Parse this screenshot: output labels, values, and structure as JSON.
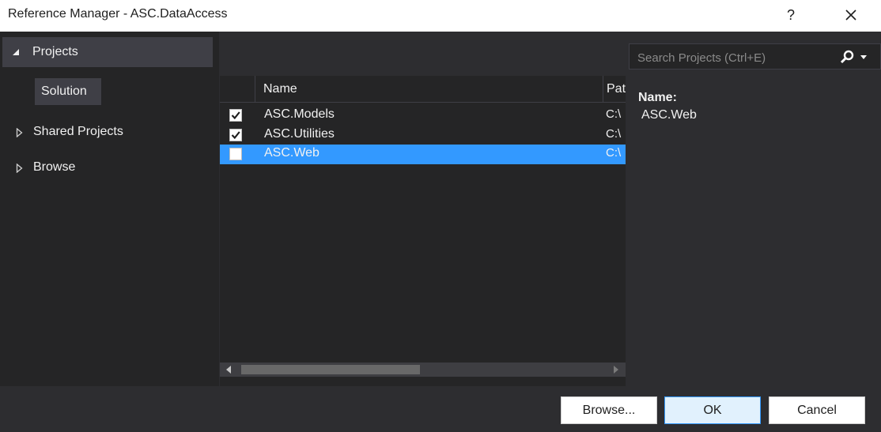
{
  "window": {
    "title": "Reference Manager - ASC.DataAccess"
  },
  "nav": {
    "header": "Projects",
    "selected_item": "Solution",
    "items": [
      {
        "label": "Shared Projects"
      },
      {
        "label": "Browse"
      }
    ]
  },
  "search": {
    "placeholder": "Search Projects (Ctrl+E)"
  },
  "list": {
    "columns": {
      "name": "Name",
      "path": "Path"
    },
    "rows": [
      {
        "name": "ASC.Models",
        "path": "C:\\",
        "checked": true,
        "selected": false
      },
      {
        "name": "ASC.Utilities",
        "path": "C:\\",
        "checked": true,
        "selected": false
      },
      {
        "name": "ASC.Web",
        "path": "C:\\",
        "checked": false,
        "selected": true
      }
    ]
  },
  "details": {
    "label": "Name:",
    "value": "ASC.Web"
  },
  "buttons": {
    "browse": "Browse...",
    "ok": "OK",
    "cancel": "Cancel"
  },
  "colors": {
    "selection": "#3399ff",
    "background": "#2d2d30",
    "panel": "#252526"
  }
}
